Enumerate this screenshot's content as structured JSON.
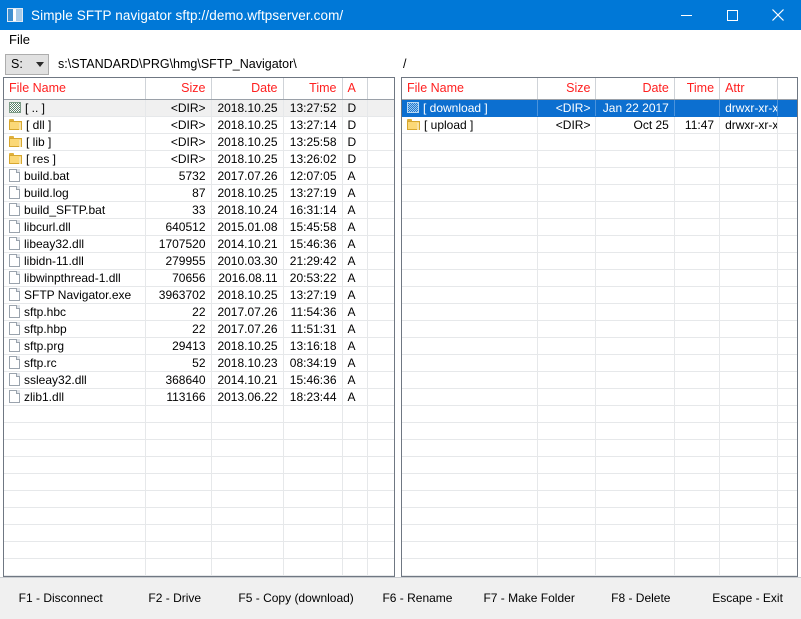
{
  "window": {
    "title": "Simple SFTP navigator sftp://demo.wftpserver.com/",
    "icon": "app-panel-icon",
    "minimize_label": "—",
    "maximize_label": "☐",
    "close_label": "✕",
    "accent_color": "#0078d7",
    "header_text_color": "#ff2020"
  },
  "menu": {
    "items": [
      {
        "label": "File"
      }
    ]
  },
  "toolbar": {
    "drive_value": "S:",
    "drive_icon": "chevron-down-icon",
    "local_path": "s:\\STANDARD\\PRG\\hmg\\SFTP_Navigator\\",
    "remote_path": "/"
  },
  "local_pane": {
    "columns": [
      {
        "label": "File Name",
        "align": "left"
      },
      {
        "label": "Size",
        "align": "right"
      },
      {
        "label": "Date",
        "align": "right"
      },
      {
        "label": "Time",
        "align": "right"
      },
      {
        "label": "A",
        "align": "left"
      },
      {
        "label": "",
        "align": "left"
      }
    ],
    "rows": [
      {
        "icon": "updir-icon",
        "name": "[ .. ]",
        "size": "<DIR>",
        "date": "2018.10.25",
        "time": "13:27:52",
        "attr": "D",
        "state": "focus"
      },
      {
        "icon": "folder-icon",
        "name": "[ dll ]",
        "size": "<DIR>",
        "date": "2018.10.25",
        "time": "13:27:14",
        "attr": "D",
        "state": ""
      },
      {
        "icon": "folder-icon",
        "name": "[ lib ]",
        "size": "<DIR>",
        "date": "2018.10.25",
        "time": "13:25:58",
        "attr": "D",
        "state": ""
      },
      {
        "icon": "folder-icon",
        "name": "[ res ]",
        "size": "<DIR>",
        "date": "2018.10.25",
        "time": "13:26:02",
        "attr": "D",
        "state": ""
      },
      {
        "icon": "file-icon",
        "name": "build.bat",
        "size": "5732",
        "date": "2017.07.26",
        "time": "12:07:05",
        "attr": "A",
        "state": ""
      },
      {
        "icon": "file-icon",
        "name": "build.log",
        "size": "87",
        "date": "2018.10.25",
        "time": "13:27:19",
        "attr": "A",
        "state": ""
      },
      {
        "icon": "file-icon",
        "name": "build_SFTP.bat",
        "size": "33",
        "date": "2018.10.24",
        "time": "16:31:14",
        "attr": "A",
        "state": ""
      },
      {
        "icon": "file-icon",
        "name": "libcurl.dll",
        "size": "640512",
        "date": "2015.01.08",
        "time": "15:45:58",
        "attr": "A",
        "state": ""
      },
      {
        "icon": "file-icon",
        "name": "libeay32.dll",
        "size": "1707520",
        "date": "2014.10.21",
        "time": "15:46:36",
        "attr": "A",
        "state": ""
      },
      {
        "icon": "file-icon",
        "name": "libidn-11.dll",
        "size": "279955",
        "date": "2010.03.30",
        "time": "21:29:42",
        "attr": "A",
        "state": ""
      },
      {
        "icon": "file-icon",
        "name": "libwinpthread-1.dll",
        "size": "70656",
        "date": "2016.08.11",
        "time": "20:53:22",
        "attr": "A",
        "state": ""
      },
      {
        "icon": "file-icon",
        "name": "SFTP Navigator.exe",
        "size": "3963702",
        "date": "2018.10.25",
        "time": "13:27:19",
        "attr": "A",
        "state": ""
      },
      {
        "icon": "file-icon",
        "name": "sftp.hbc",
        "size": "22",
        "date": "2017.07.26",
        "time": "11:54:36",
        "attr": "A",
        "state": ""
      },
      {
        "icon": "file-icon",
        "name": "sftp.hbp",
        "size": "22",
        "date": "2017.07.26",
        "time": "11:51:31",
        "attr": "A",
        "state": ""
      },
      {
        "icon": "file-icon",
        "name": "sftp.prg",
        "size": "29413",
        "date": "2018.10.25",
        "time": "13:16:18",
        "attr": "A",
        "state": ""
      },
      {
        "icon": "file-icon",
        "name": "sftp.rc",
        "size": "52",
        "date": "2018.10.23",
        "time": "08:34:19",
        "attr": "A",
        "state": ""
      },
      {
        "icon": "file-icon",
        "name": "ssleay32.dll",
        "size": "368640",
        "date": "2014.10.21",
        "time": "15:46:36",
        "attr": "A",
        "state": ""
      },
      {
        "icon": "file-icon",
        "name": "zlib1.dll",
        "size": "113166",
        "date": "2013.06.22",
        "time": "18:23:44",
        "attr": "A",
        "state": ""
      }
    ],
    "empty_rows": 10
  },
  "remote_pane": {
    "columns": [
      {
        "label": "File Name",
        "align": "left"
      },
      {
        "label": "Size",
        "align": "right"
      },
      {
        "label": "Date",
        "align": "right"
      },
      {
        "label": "Time",
        "align": "right"
      },
      {
        "label": "Attr",
        "align": "left"
      },
      {
        "label": "",
        "align": "left"
      }
    ],
    "rows": [
      {
        "icon": "updir-icon",
        "name": "[ download ]",
        "size": "<DIR>",
        "date": "Jan 22 2017",
        "time": "",
        "attr": "drwxr-xr-x",
        "state": "selected"
      },
      {
        "icon": "folder-icon",
        "name": "[ upload ]",
        "size": "<DIR>",
        "date": "Oct 25",
        "time": "11:47",
        "attr": "drwxr-xr-x",
        "state": ""
      }
    ],
    "empty_rows": 26
  },
  "function_bar": {
    "keys": [
      {
        "label": "F1 - Disconnect"
      },
      {
        "label": "F2 - Drive"
      },
      {
        "label": "F5 - Copy (download)"
      },
      {
        "label": "F6 - Rename"
      },
      {
        "label": "F7 - Make Folder"
      },
      {
        "label": "F8 - Delete"
      },
      {
        "label": "Escape - Exit"
      }
    ]
  }
}
